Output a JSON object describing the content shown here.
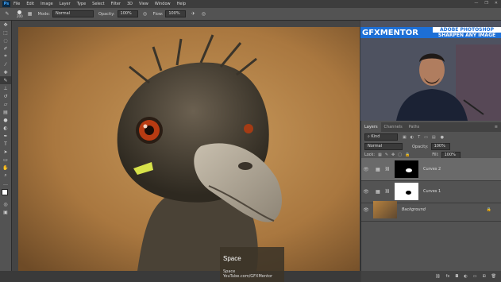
{
  "app": {
    "logo": "Ps"
  },
  "menu": [
    "File",
    "Edit",
    "Image",
    "Layer",
    "Type",
    "Select",
    "Filter",
    "3D",
    "View",
    "Window",
    "Help"
  ],
  "window_controls": [
    "—",
    "❐",
    "✕"
  ],
  "options": {
    "size_value": "200",
    "mode_label": "Mode:",
    "mode_value": "Normal",
    "opacity_label": "Opacity:",
    "opacity_value": "100%",
    "flow_label": "Flow:",
    "flow_value": "100%"
  },
  "tools": [
    "move",
    "marquee",
    "lasso",
    "quick-select",
    "crop",
    "eyedropper",
    "healing",
    "brush",
    "stamp",
    "history-brush",
    "eraser",
    "gradient",
    "blur",
    "dodge",
    "pen",
    "type",
    "path-select",
    "shape",
    "hand",
    "zoom",
    "more",
    "fg-bg",
    "quick-mask",
    "screen-mode"
  ],
  "branding": {
    "logo_text": "GFXMENTOR",
    "title_line1": "ADOBE PHOTOSHOP",
    "title_line2": "SHARPEN ANY IMAGE"
  },
  "panel": {
    "tabs": [
      "Layers",
      "Channels",
      "Paths"
    ],
    "filter_label": "Kind",
    "blend_mode": "Normal",
    "opacity_label": "Opacity:",
    "opacity_value": "100%",
    "lock_label": "Lock:",
    "fill_label": "Fill:",
    "fill_value": "100%",
    "layers": [
      {
        "name": "Curves 2"
      },
      {
        "name": "Curves 1"
      },
      {
        "name": "Background"
      }
    ]
  },
  "overlay": {
    "title": "Space",
    "line1": "Space",
    "line2": "YouTube.com/GFXMentor"
  },
  "colors": {
    "accent": "#1d6fd6",
    "panel": "#535353",
    "bg": "#3c3c3c"
  }
}
